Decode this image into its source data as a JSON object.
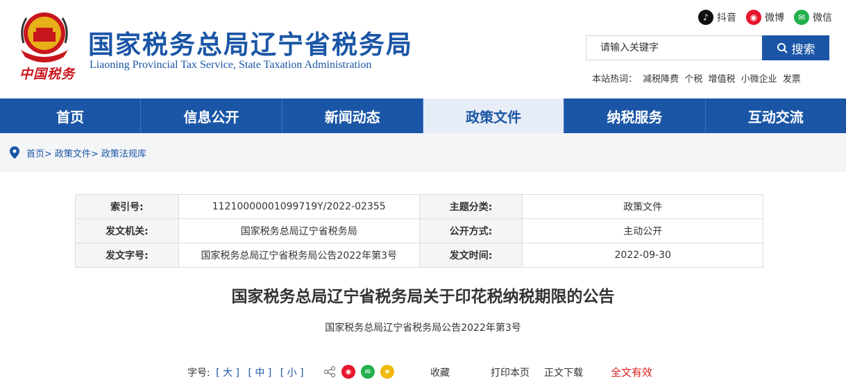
{
  "header": {
    "title": "国家税务总局辽宁省税务局",
    "subtitle": "Liaoning Provincial Tax Service, State Taxation Administration",
    "logo_script": "中国税务",
    "social": [
      {
        "label": "抖音",
        "icon": "douyin-icon",
        "color": "#111111"
      },
      {
        "label": "微博",
        "icon": "weibo-icon",
        "color": "#e6162d"
      },
      {
        "label": "微信",
        "icon": "wechat-icon",
        "color": "#22b14c"
      }
    ],
    "search": {
      "placeholder": "请输入关键字",
      "button": "搜索"
    },
    "hot": {
      "label": "本站热词：",
      "words": [
        "减税降费",
        "个税",
        "增值税",
        "小微企业",
        "发票"
      ]
    }
  },
  "nav": {
    "tabs": [
      "首页",
      "信息公开",
      "新闻动态",
      "政策文件",
      "纳税服务",
      "互动交流"
    ],
    "active_index": 3
  },
  "breadcrumb": [
    "首页>",
    "政策文件>",
    "政策法规库"
  ],
  "meta": [
    {
      "k1": "索引号:",
      "v1": "11210000001099719Y/2022-02355",
      "k2": "主题分类:",
      "v2": "政策文件"
    },
    {
      "k1": "发文机关:",
      "v1": "国家税务总局辽宁省税务局",
      "k2": "公开方式:",
      "v2": "主动公开"
    },
    {
      "k1": "发文字号:",
      "v1": "国家税务总局辽宁省税务局公告2022年第3号",
      "k2": "发文时间:",
      "v2": "2022-09-30"
    }
  ],
  "doc": {
    "title": "国家税务总局辽宁省税务局关于印花税纳税期限的公告",
    "number": "国家税务总局辽宁省税务局公告2022年第3号"
  },
  "tools": {
    "font_size_label": "字号:",
    "sizes": [
      "[ 大 ]",
      "[ 中 ]",
      "[ 小 ]"
    ],
    "favorite": "收藏",
    "print": "打印本页",
    "download": "正文下载",
    "valid": "全文有效"
  },
  "colors": {
    "brand": "#1b56a6",
    "accent_red": "#e02020"
  }
}
